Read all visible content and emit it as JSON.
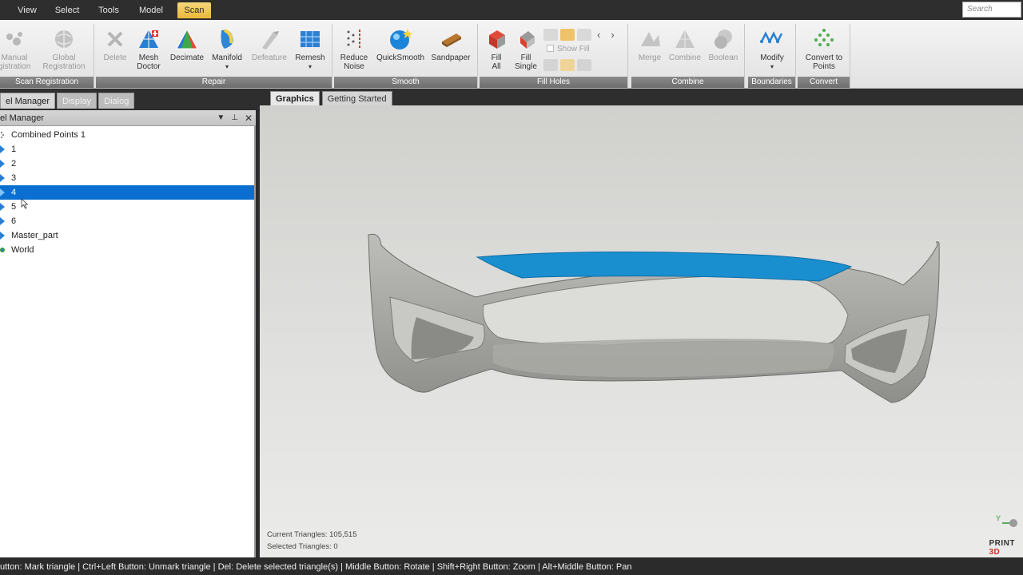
{
  "menu": {
    "items": [
      {
        "label": "View",
        "active": false
      },
      {
        "label": "Select",
        "active": false
      },
      {
        "label": "Tools",
        "active": false
      },
      {
        "label": "Model",
        "active": false
      },
      {
        "label": "Scan",
        "active": true
      }
    ],
    "search_placeholder": "Search"
  },
  "ribbon": {
    "groups": [
      {
        "label": "Scan Registration",
        "tools": [
          {
            "label1": "Manual",
            "label2": "gistration",
            "icon": "manual-registration-icon",
            "enabled": false
          },
          {
            "label1": "Global",
            "label2": "Registration",
            "icon": "global-registration-icon",
            "enabled": false
          }
        ]
      },
      {
        "label": "Repair",
        "tools": [
          {
            "label1": "Delete",
            "label2": "",
            "icon": "delete-icon",
            "enabled": false
          },
          {
            "label1": "Mesh",
            "label2": "Doctor",
            "icon": "mesh-doctor-icon",
            "enabled": true
          },
          {
            "label1": "Decimate",
            "label2": "",
            "icon": "decimate-icon",
            "enabled": true
          },
          {
            "label1": "Manifold",
            "label2": "",
            "icon": "manifold-icon",
            "enabled": true
          },
          {
            "label1": "Defeature",
            "label2": "",
            "icon": "defeature-icon",
            "enabled": false
          },
          {
            "label1": "Remesh",
            "label2": "",
            "icon": "remesh-icon",
            "enabled": true
          }
        ]
      },
      {
        "label": "Smooth",
        "tools": [
          {
            "label1": "Reduce",
            "label2": "Noise",
            "icon": "reduce-noise-icon",
            "enabled": true
          },
          {
            "label1": "QuickSmooth",
            "label2": "",
            "icon": "quicksmooth-icon",
            "enabled": true
          },
          {
            "label1": "Sandpaper",
            "label2": "",
            "icon": "sandpaper-icon",
            "enabled": true
          }
        ]
      },
      {
        "label": "Fill Holes",
        "tools": [
          {
            "label1": "Fill",
            "label2": "All",
            "icon": "fill-all-icon",
            "enabled": true
          },
          {
            "label1": "Fill",
            "label2": "Single",
            "icon": "fill-single-icon",
            "enabled": true
          }
        ],
        "show_fill_label": "Show Fill"
      },
      {
        "label": "Combine",
        "tools": [
          {
            "label1": "Merge",
            "label2": "",
            "icon": "merge-icon",
            "enabled": false
          },
          {
            "label1": "Combine",
            "label2": "",
            "icon": "combine-icon",
            "enabled": false
          },
          {
            "label1": "Boolean",
            "label2": "",
            "icon": "boolean-icon",
            "enabled": false
          }
        ]
      },
      {
        "label": "Boundaries",
        "tools": [
          {
            "label1": "Modify",
            "label2": "",
            "icon": "modify-icon",
            "enabled": true
          }
        ]
      },
      {
        "label": "Convert",
        "tools": [
          {
            "label1": "Convert to",
            "label2": "Points",
            "icon": "convert-to-points-icon",
            "enabled": true
          }
        ]
      }
    ]
  },
  "left_panel": {
    "tabs": [
      {
        "label": "el Manager",
        "active": true
      },
      {
        "label": "Display",
        "active": false
      },
      {
        "label": "Dialog",
        "active": false
      }
    ],
    "header": "el Manager",
    "tree": [
      {
        "label": "Combined Points 1",
        "icon": "points-icon",
        "selected": false
      },
      {
        "label": "1",
        "icon": "mesh-icon",
        "selected": false
      },
      {
        "label": "2",
        "icon": "mesh-icon",
        "selected": false
      },
      {
        "label": "3",
        "icon": "mesh-icon",
        "selected": false
      },
      {
        "label": "4",
        "icon": "mesh-icon",
        "selected": true
      },
      {
        "label": "5",
        "icon": "mesh-icon",
        "selected": false
      },
      {
        "label": "6",
        "icon": "mesh-icon",
        "selected": false
      },
      {
        "label": "Master_part",
        "icon": "mesh-icon",
        "selected": false
      },
      {
        "label": "World",
        "icon": "globe-icon",
        "selected": false
      }
    ]
  },
  "viewport": {
    "tabs": [
      {
        "label": "Graphics",
        "active": true
      },
      {
        "label": "Getting Started",
        "active": false
      }
    ],
    "current_triangles": "Current Triangles: 105,515",
    "selected_triangles": "Selected Triangles: 0",
    "axis_label": "Y",
    "logo_top": "PRINT",
    "logo_bottom": "3D"
  },
  "colors": {
    "selection": "#0a6fd1",
    "mesh": "#9a9a96",
    "highlight": "#1a8fcf",
    "scan_tab": "#e9b83c"
  },
  "status_bar": "utton: Mark triangle | Ctrl+Left Button: Unmark triangle | Del: Delete selected triangle(s) | Middle Button: Rotate | Shift+Right Button: Zoom | Alt+Middle Button: Pan"
}
